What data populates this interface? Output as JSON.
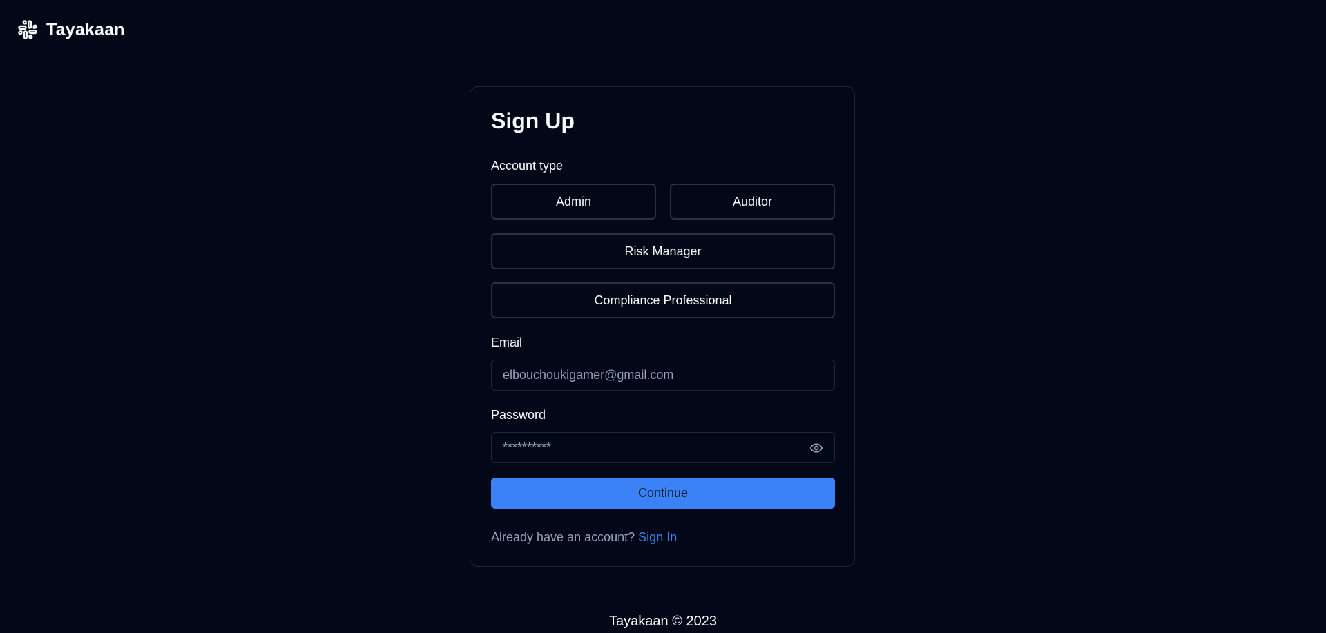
{
  "header": {
    "brand": "Tayakaan",
    "logo_icon": "slack-style-hash-icon"
  },
  "form": {
    "title": "Sign Up",
    "account_type_label": "Account type",
    "account_types": [
      "Admin",
      "Auditor",
      "Risk Manager",
      "Compliance Professional"
    ],
    "email_label": "Email",
    "email_value": "elbouchoukigamer@gmail.com",
    "password_label": "Password",
    "password_value": "**********",
    "password_toggle_icon": "eye-icon",
    "continue_label": "Continue",
    "signin_prompt": "Already have an account?",
    "signin_link": "Sign In"
  },
  "footer": {
    "text": "Tayakaan © 2023"
  },
  "colors": {
    "background": "#020817",
    "border": "#1e293b",
    "accent": "#3b82f6",
    "text": "#f8fafc",
    "muted": "#94a3b8"
  }
}
